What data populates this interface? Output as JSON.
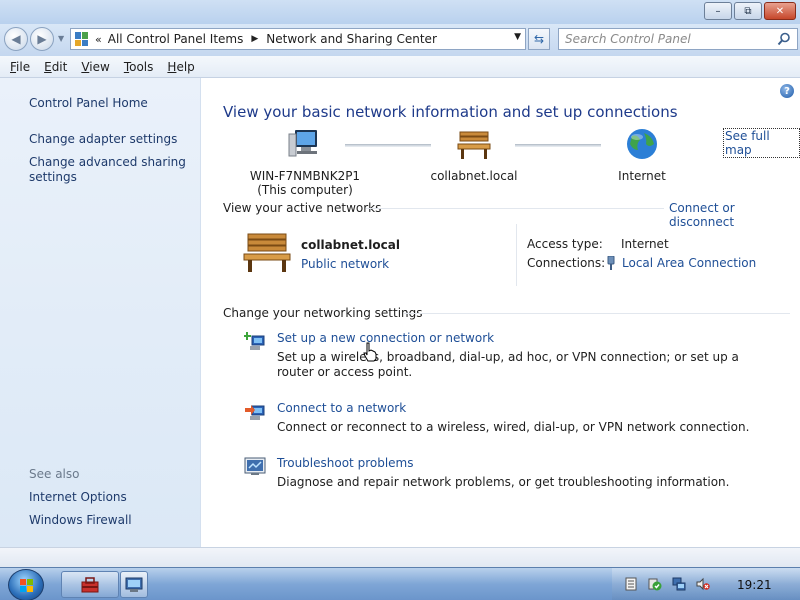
{
  "window": {
    "minimize_glyph": "–",
    "maximize_glyph": "⧉",
    "close_glyph": "✕"
  },
  "address_bar": {
    "overflow": "«",
    "crumbs": [
      "All Control Panel Items",
      "Network and Sharing Center"
    ],
    "search_placeholder": "Search Control Panel"
  },
  "menu": {
    "items": [
      {
        "label": "File",
        "accel": "F",
        "rest": "ile"
      },
      {
        "label": "Edit",
        "accel": "E",
        "rest": "dit"
      },
      {
        "label": "View",
        "accel": "V",
        "rest": "iew"
      },
      {
        "label": "Tools",
        "accel": "T",
        "rest": "ools"
      },
      {
        "label": "Help",
        "accel": "H",
        "rest": "elp"
      }
    ]
  },
  "sidebar": {
    "home": "Control Panel Home",
    "links": [
      "Change adapter settings",
      "Change advanced sharing settings"
    ],
    "see_also": "See also",
    "see_also_links": [
      "Internet Options",
      "Windows Firewall"
    ]
  },
  "main": {
    "title": "View your basic network information and set up connections",
    "see_full_map": "See full map",
    "nodes": {
      "computer_name": "WIN-F7NMBNK2P1",
      "computer_sub": "(This computer)",
      "domain": "collabnet.local",
      "internet": "Internet"
    },
    "active_networks": {
      "heading": "View your active networks",
      "connect_disconnect": "Connect or disconnect",
      "network_name": "collabnet.local",
      "network_type": "Public network",
      "access_type_label": "Access type:",
      "access_type_value": "Internet",
      "connections_label": "Connections:",
      "connection_name": "Local Area Connection"
    },
    "settings": {
      "heading": "Change your networking settings",
      "tasks": [
        {
          "link": "Set up a new connection or network",
          "desc": "Set up a wireless, broadband, dial-up, ad hoc, or VPN connection; or set up a router or access point."
        },
        {
          "link": "Connect to a network",
          "desc": "Connect or reconnect to a wireless, wired, dial-up, or VPN network connection."
        },
        {
          "link": "Troubleshoot problems",
          "desc": "Diagnose and repair network problems, or get troubleshooting information."
        }
      ]
    }
  },
  "taskbar": {
    "clock": "19:21"
  },
  "colors": {
    "link": "#1e4e96",
    "title": "#1e3a8a",
    "sidebar_bg": "#dbe8f6"
  }
}
